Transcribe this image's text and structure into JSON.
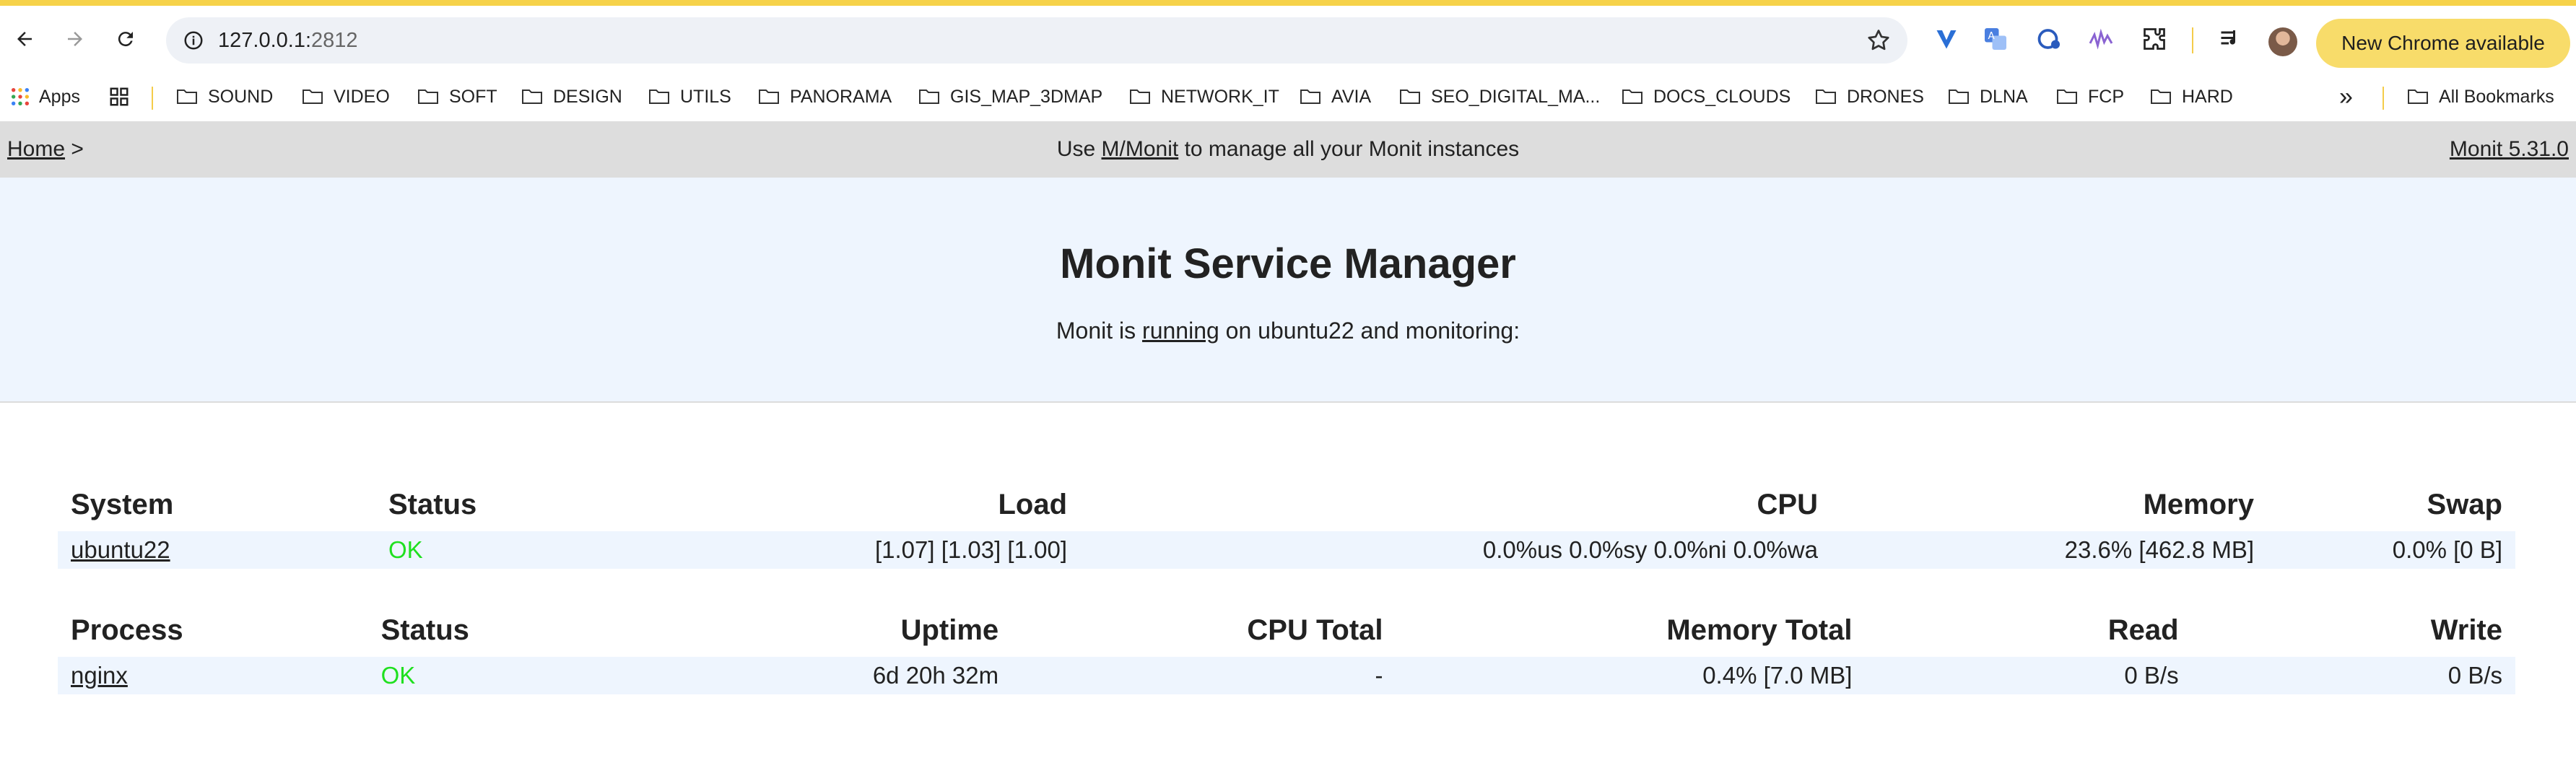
{
  "browser": {
    "url_host": "127.0.0.1:",
    "url_port": "2812",
    "update_label": "New Chrome available",
    "bookmarks": {
      "apps_label": "Apps",
      "folders": [
        "SOUND",
        "VIDEO",
        "SOFT",
        "DESIGN",
        "UTILS",
        "PANORAMA",
        "GIS_MAP_3DMAP",
        "NETWORK_IT",
        "AVIA",
        "SEO_DIGITAL_MA...",
        "DOCS_CLOUDS",
        "DRONES",
        "DLNA",
        "FCP",
        "HARD"
      ],
      "overflow_label": "»",
      "all_bookmarks_label": "All Bookmarks"
    }
  },
  "header": {
    "home_label": "Home",
    "home_sep": ">",
    "center_prefix": "Use",
    "center_link": "M/Monit",
    "center_suffix": "to manage all your Monit instances",
    "version_label": "Monit 5.31.0"
  },
  "hero": {
    "title": "Monit Service Manager",
    "sub_prefix": "Monit is",
    "sub_link": "running",
    "sub_suffix": "on ubuntu22 and monitoring:"
  },
  "system_table": {
    "headers": [
      "System",
      "Status",
      "Load",
      "CPU",
      "Memory",
      "Swap"
    ],
    "row": {
      "name": "ubuntu22",
      "status": "OK",
      "load": "[1.07] [1.03] [1.00]",
      "cpu": "0.0%us 0.0%sy 0.0%ni 0.0%wa",
      "memory": "23.6% [462.8 MB]",
      "swap": "0.0% [0 B]"
    }
  },
  "process_table": {
    "headers": [
      "Process",
      "Status",
      "Uptime",
      "CPU Total",
      "Memory Total",
      "Read",
      "Write"
    ],
    "row": {
      "name": "nginx",
      "status": "OK",
      "uptime": "6d 20h 32m",
      "cpu_total": "-",
      "memory_total": "0.4% [7.0 MB]",
      "read": "0 B/s",
      "write": "0 B/s"
    }
  },
  "colors": {
    "ok": "#1fe01f",
    "hero_bg": "#eef5fe",
    "header_bg": "#dddddd",
    "update_pill": "#f8dc6a"
  }
}
